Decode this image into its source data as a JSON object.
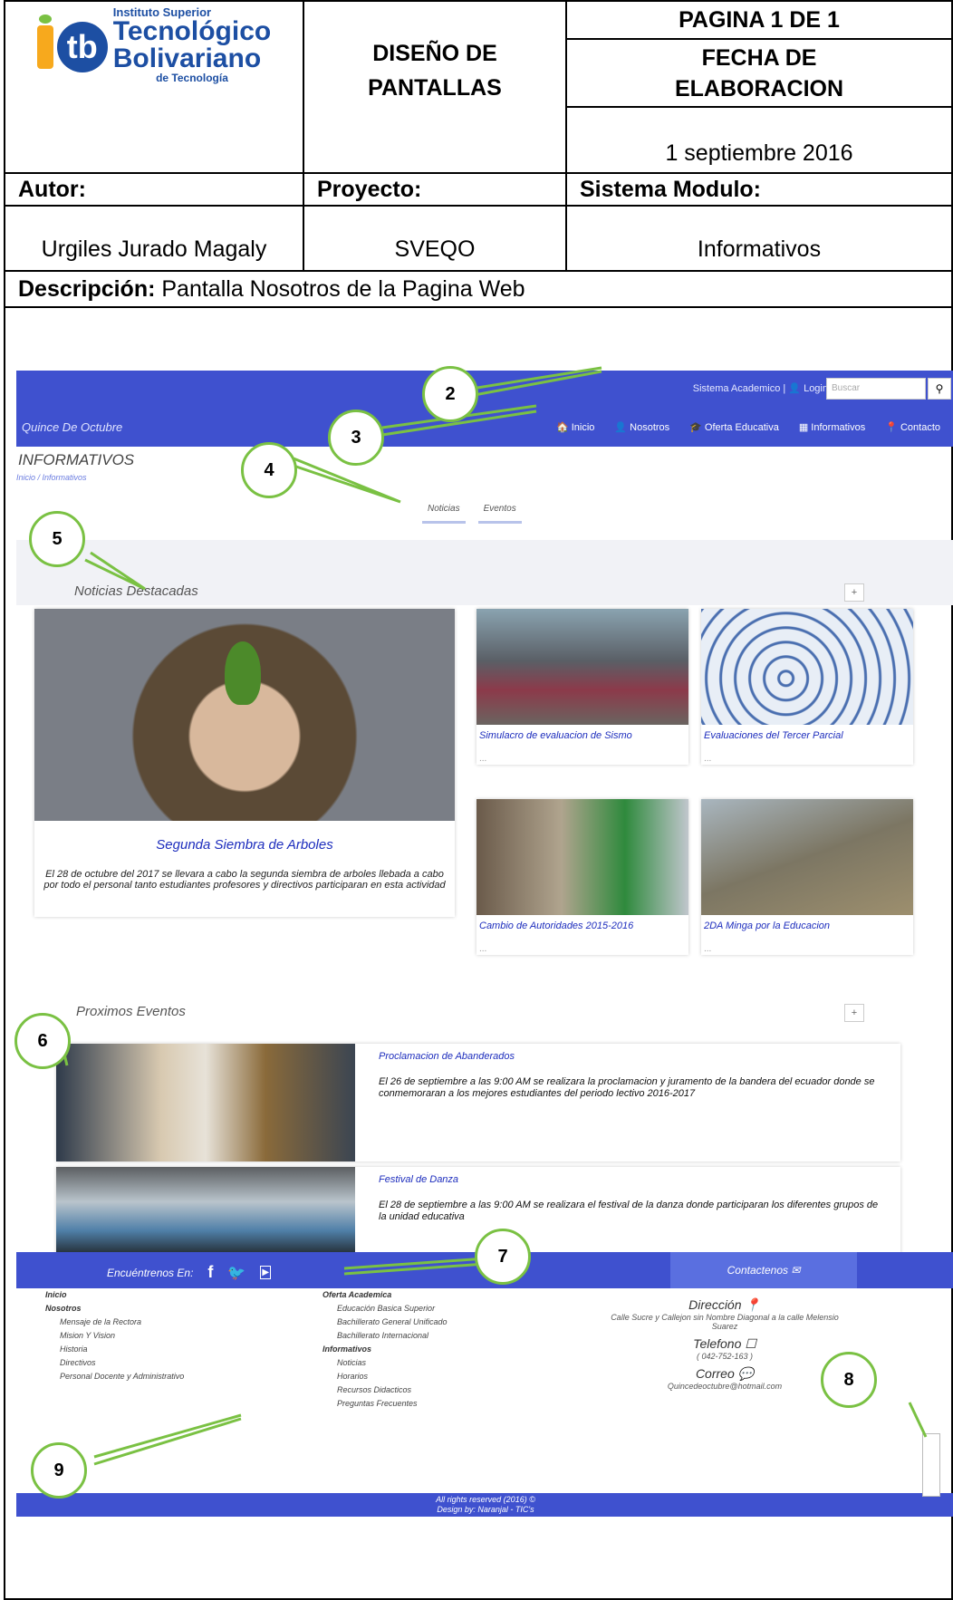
{
  "header": {
    "logo": {
      "line1": "Instituto Superior",
      "line2": "Tecnológico",
      "line3": "Bolivariano",
      "line4": "de Tecnología"
    },
    "doc_title": "DISEÑO DE PANTALLAS",
    "page": "PAGINA 1 DE 1",
    "date_label": "FECHA DE ELABORACION",
    "date_value": "1 septiembre 2016",
    "author_label": "Autor:",
    "project_label": "Proyecto:",
    "system_label": "Sistema Modulo:",
    "author": "Urgiles Jurado Magaly",
    "project": "SVEQO",
    "system": "Informativos",
    "desc_label": "Descripción:",
    "desc": " Pantalla Nosotros de la Pagina Web"
  },
  "site": {
    "top_links": "Sistema Academico | 👤 Login",
    "search_placeholder": "Buscar",
    "brand": "Quince De Octubre",
    "nav": [
      "🏠 Inicio",
      "👤 Nosotros",
      "🎓 Oferta Educativa",
      "▦ Informativos",
      "📍 Contacto"
    ],
    "page_title": "INFORMATIVOS",
    "breadcrumb": "Inicio  /  Informativos",
    "tabs": [
      "Noticias",
      "Eventos"
    ],
    "section_news": "Noticias Destacadas",
    "plus": "+",
    "featured": {
      "title": "Segunda Siembra de Arboles",
      "text": "El 28 de octubre del 2017 se llevara a cabo la segunda siembra de arboles llebada a cabo por todo el personal tanto estudiantes profesores y directivos participaran en esta actividad"
    },
    "cards": [
      {
        "title": "Simulacro de evaluacion de Sismo",
        "dots": "..."
      },
      {
        "title": "Evaluaciones del Tercer Parcial",
        "dots": "..."
      },
      {
        "title": "Cambio de Autoridades 2015-2016",
        "dots": "..."
      },
      {
        "title": "2DA Minga por la Educacion",
        "dots": "..."
      }
    ],
    "section_events": "Proximos Eventos",
    "events": [
      {
        "title": "Proclamacion de Abanderados",
        "text": "El 26 de septiembre a las 9:00 AM se realizara la proclamacion y juramento de la bandera del ecuador donde se conmemoraran a los mejores estudiantes del periodo lectivo 2016-2017"
      },
      {
        "title": "Festival de Danza",
        "text": "El 28 de septiembre a las 9:00 AM se realizara el festival de la danza donde participaran los diferentes grupos de la unidad educativa"
      }
    ],
    "footer": {
      "find_us": "Encuéntrenos En:",
      "contact": "Contactenos ✉",
      "col1": {
        "inicio": "Inicio",
        "nosotros": "Nosotros",
        "items": [
          "Mensaje de la Rectora",
          "Mision Y Vision",
          "Historia",
          "Directivos",
          "Personal Docente y Administrativo"
        ]
      },
      "col2": {
        "oferta": "Oferta Academica",
        "oferta_items": [
          "Educación Basica Superior",
          "Bachillerato General Unificado",
          "Bachillerato Internacional"
        ],
        "info": "Informativos",
        "info_items": [
          "Noticias",
          "Horarios",
          "Recursos Didacticos",
          "Preguntas Frecuentes"
        ]
      },
      "direccion": "Dirección 📍",
      "direccion_text": "Calle Sucre y Callejon sin Nombre Diagonal a la calle Melensio Suarez",
      "telefono": "Telefono ☐",
      "telefono_text": "( 042-752-163 )",
      "correo": "Correo 💬",
      "correo_text": "Quincedeoctubre@hotmail.com",
      "rights": "All rights reserved (2016) ©",
      "design": "Design by: Naranjal - TIC's"
    }
  },
  "callouts": [
    "2",
    "3",
    "4",
    "5",
    "6",
    "7",
    "8",
    "9"
  ],
  "colors": {
    "navbar": "#3f51cf",
    "callout_border": "#7ac143",
    "link": "#1d2dbd"
  }
}
